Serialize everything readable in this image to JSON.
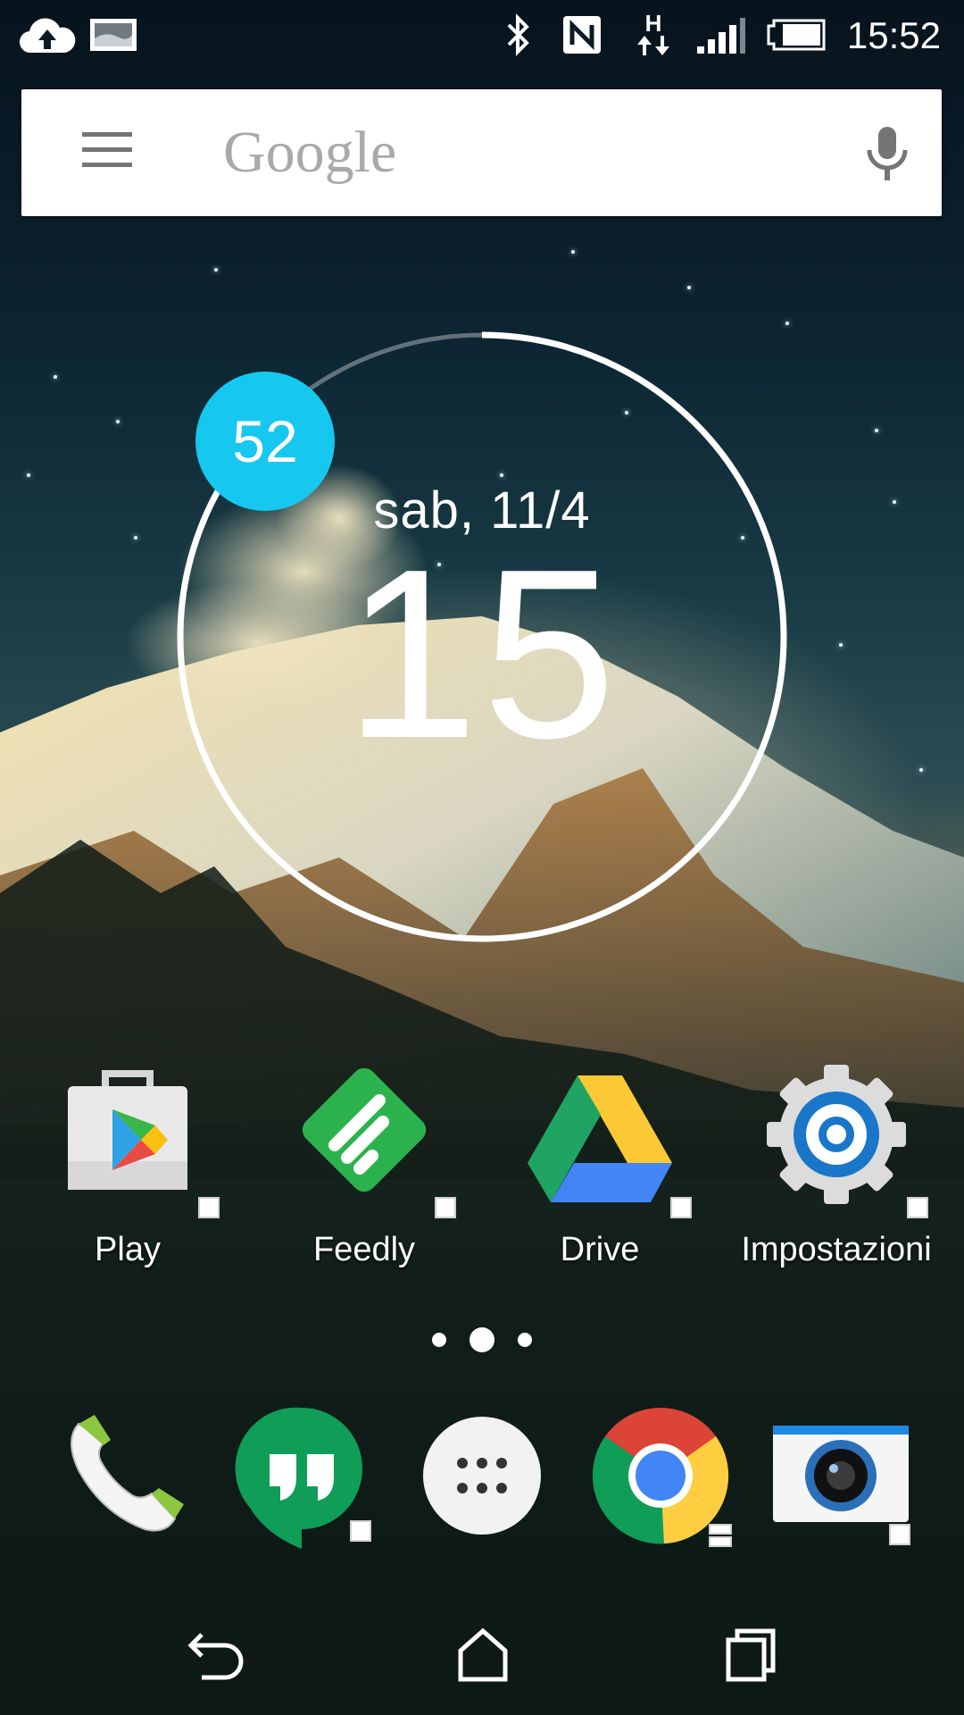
{
  "status_bar": {
    "time": "15:52",
    "icons": [
      "cloud-upload-icon",
      "image-icon",
      "bluetooth-icon",
      "nfc-icon",
      "hspa-data-icon",
      "signal-icon",
      "battery-icon"
    ],
    "network_type": "H"
  },
  "search": {
    "logo_text": "Google",
    "icons": [
      "menu-icon",
      "mic-icon"
    ]
  },
  "clock_widget": {
    "date": "sab, 11/4",
    "hour": "15",
    "minute": "52",
    "minute_progress": 0.867,
    "accent_color": "#16c8ef"
  },
  "apps": [
    {
      "label": "Play",
      "icon": "play-store-icon"
    },
    {
      "label": "Feedly",
      "icon": "feedly-icon"
    },
    {
      "label": "Drive",
      "icon": "drive-icon"
    },
    {
      "label": "Impostazioni",
      "icon": "settings-icon"
    }
  ],
  "page_indicator": {
    "pages": 3,
    "current": 2
  },
  "dock": [
    {
      "icon": "phone-icon"
    },
    {
      "icon": "hangouts-icon"
    },
    {
      "icon": "app-drawer-icon"
    },
    {
      "icon": "chrome-icon"
    },
    {
      "icon": "camera-icon"
    }
  ],
  "nav_bar": {
    "icons": [
      "back-icon",
      "home-icon",
      "recents-icon"
    ]
  }
}
